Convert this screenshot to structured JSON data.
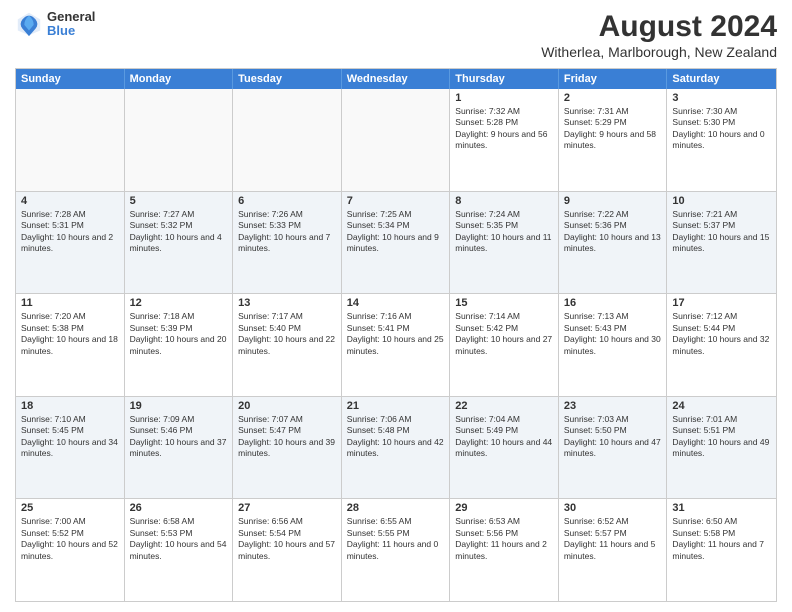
{
  "header": {
    "logo": {
      "line1": "General",
      "line2": "Blue"
    },
    "title": "August 2024",
    "subtitle": "Witherlea, Marlborough, New Zealand"
  },
  "days_of_week": [
    "Sunday",
    "Monday",
    "Tuesday",
    "Wednesday",
    "Thursday",
    "Friday",
    "Saturday"
  ],
  "weeks": [
    [
      {
        "day": "",
        "info": "",
        "empty": true
      },
      {
        "day": "",
        "info": "",
        "empty": true
      },
      {
        "day": "",
        "info": "",
        "empty": true
      },
      {
        "day": "",
        "info": "",
        "empty": true
      },
      {
        "day": "1",
        "info": "Sunrise: 7:32 AM\nSunset: 5:28 PM\nDaylight: 9 hours and 56 minutes."
      },
      {
        "day": "2",
        "info": "Sunrise: 7:31 AM\nSunset: 5:29 PM\nDaylight: 9 hours and 58 minutes."
      },
      {
        "day": "3",
        "info": "Sunrise: 7:30 AM\nSunset: 5:30 PM\nDaylight: 10 hours and 0 minutes."
      }
    ],
    [
      {
        "day": "4",
        "info": "Sunrise: 7:28 AM\nSunset: 5:31 PM\nDaylight: 10 hours and 2 minutes."
      },
      {
        "day": "5",
        "info": "Sunrise: 7:27 AM\nSunset: 5:32 PM\nDaylight: 10 hours and 4 minutes."
      },
      {
        "day": "6",
        "info": "Sunrise: 7:26 AM\nSunset: 5:33 PM\nDaylight: 10 hours and 7 minutes."
      },
      {
        "day": "7",
        "info": "Sunrise: 7:25 AM\nSunset: 5:34 PM\nDaylight: 10 hours and 9 minutes."
      },
      {
        "day": "8",
        "info": "Sunrise: 7:24 AM\nSunset: 5:35 PM\nDaylight: 10 hours and 11 minutes."
      },
      {
        "day": "9",
        "info": "Sunrise: 7:22 AM\nSunset: 5:36 PM\nDaylight: 10 hours and 13 minutes."
      },
      {
        "day": "10",
        "info": "Sunrise: 7:21 AM\nSunset: 5:37 PM\nDaylight: 10 hours and 15 minutes."
      }
    ],
    [
      {
        "day": "11",
        "info": "Sunrise: 7:20 AM\nSunset: 5:38 PM\nDaylight: 10 hours and 18 minutes."
      },
      {
        "day": "12",
        "info": "Sunrise: 7:18 AM\nSunset: 5:39 PM\nDaylight: 10 hours and 20 minutes."
      },
      {
        "day": "13",
        "info": "Sunrise: 7:17 AM\nSunset: 5:40 PM\nDaylight: 10 hours and 22 minutes."
      },
      {
        "day": "14",
        "info": "Sunrise: 7:16 AM\nSunset: 5:41 PM\nDaylight: 10 hours and 25 minutes."
      },
      {
        "day": "15",
        "info": "Sunrise: 7:14 AM\nSunset: 5:42 PM\nDaylight: 10 hours and 27 minutes."
      },
      {
        "day": "16",
        "info": "Sunrise: 7:13 AM\nSunset: 5:43 PM\nDaylight: 10 hours and 30 minutes."
      },
      {
        "day": "17",
        "info": "Sunrise: 7:12 AM\nSunset: 5:44 PM\nDaylight: 10 hours and 32 minutes."
      }
    ],
    [
      {
        "day": "18",
        "info": "Sunrise: 7:10 AM\nSunset: 5:45 PM\nDaylight: 10 hours and 34 minutes."
      },
      {
        "day": "19",
        "info": "Sunrise: 7:09 AM\nSunset: 5:46 PM\nDaylight: 10 hours and 37 minutes."
      },
      {
        "day": "20",
        "info": "Sunrise: 7:07 AM\nSunset: 5:47 PM\nDaylight: 10 hours and 39 minutes."
      },
      {
        "day": "21",
        "info": "Sunrise: 7:06 AM\nSunset: 5:48 PM\nDaylight: 10 hours and 42 minutes."
      },
      {
        "day": "22",
        "info": "Sunrise: 7:04 AM\nSunset: 5:49 PM\nDaylight: 10 hours and 44 minutes."
      },
      {
        "day": "23",
        "info": "Sunrise: 7:03 AM\nSunset: 5:50 PM\nDaylight: 10 hours and 47 minutes."
      },
      {
        "day": "24",
        "info": "Sunrise: 7:01 AM\nSunset: 5:51 PM\nDaylight: 10 hours and 49 minutes."
      }
    ],
    [
      {
        "day": "25",
        "info": "Sunrise: 7:00 AM\nSunset: 5:52 PM\nDaylight: 10 hours and 52 minutes."
      },
      {
        "day": "26",
        "info": "Sunrise: 6:58 AM\nSunset: 5:53 PM\nDaylight: 10 hours and 54 minutes."
      },
      {
        "day": "27",
        "info": "Sunrise: 6:56 AM\nSunset: 5:54 PM\nDaylight: 10 hours and 57 minutes."
      },
      {
        "day": "28",
        "info": "Sunrise: 6:55 AM\nSunset: 5:55 PM\nDaylight: 11 hours and 0 minutes."
      },
      {
        "day": "29",
        "info": "Sunrise: 6:53 AM\nSunset: 5:56 PM\nDaylight: 11 hours and 2 minutes."
      },
      {
        "day": "30",
        "info": "Sunrise: 6:52 AM\nSunset: 5:57 PM\nDaylight: 11 hours and 5 minutes."
      },
      {
        "day": "31",
        "info": "Sunrise: 6:50 AM\nSunset: 5:58 PM\nDaylight: 11 hours and 7 minutes."
      }
    ]
  ]
}
